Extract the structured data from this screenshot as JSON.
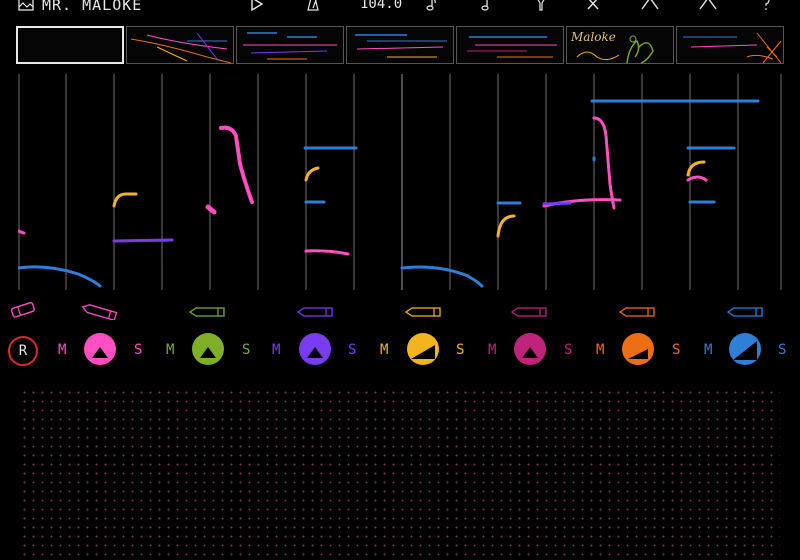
{
  "app": {
    "title": "MR. MALOKE"
  },
  "toolbar": {
    "tempo": "104.0",
    "icons": [
      "play-icon",
      "metronome-icon",
      "note-icon",
      "note-alt-icon",
      "mic-icon",
      "clear-icon",
      "undo-icon",
      "redo-icon",
      "help-icon"
    ]
  },
  "colors": {
    "pink": "#ff4fc0",
    "green": "#7fae28",
    "purple": "#7a3cf0",
    "yellow": "#f2b51f",
    "magenta": "#c0237a",
    "orange": "#ee6f13",
    "blue": "#2f7ed8",
    "record": "#d92b2b"
  },
  "tracks": [
    {
      "id": "pink",
      "mute": "M",
      "solo": "S"
    },
    {
      "id": "green",
      "mute": "M",
      "solo": "S"
    },
    {
      "id": "purple",
      "mute": "M",
      "solo": "S"
    },
    {
      "id": "yellow",
      "mute": "M",
      "solo": "S"
    },
    {
      "id": "magenta",
      "mute": "M",
      "solo": "S"
    },
    {
      "id": "orange",
      "mute": "M",
      "solo": "S"
    },
    {
      "id": "blue",
      "mute": "M",
      "solo": "S"
    }
  ],
  "record": {
    "label": "R"
  },
  "thumbnails": {
    "sketch_text": "Maloke"
  }
}
